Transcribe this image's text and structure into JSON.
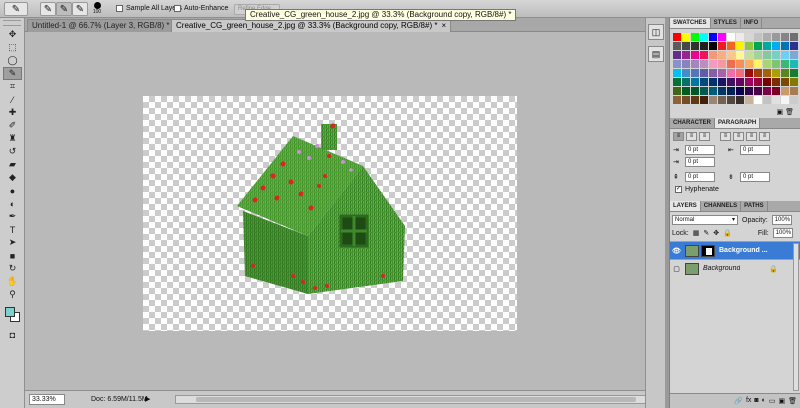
{
  "options_bar": {
    "brush_size": "100",
    "sample_all_layers": "Sample All Layers",
    "auto_enhance": "Auto-Enhance",
    "refine_edge": "Refine Edge...",
    "tooltip": "Creative_CG_green_house_2.jpg @ 33.3% (Background copy, RGB/8#) *"
  },
  "tabs": [
    {
      "label": "Untitled-1 @ 66.7% (Layer 3, RGB/8) *",
      "close": "×"
    },
    {
      "label": "Creative_CG_green_house_2.jpg @ 33.3% (Background copy, RGB/8#) *",
      "close": "×"
    }
  ],
  "status": {
    "zoom": "33.33%",
    "doc_info": "Doc: 6.59M/11.5M"
  },
  "swatches_panel": {
    "tabs": [
      "SWATCHES",
      "STYLES",
      "INFO"
    ],
    "colors": [
      "#ff0000",
      "#ffff00",
      "#00ff00",
      "#00ffff",
      "#0000ff",
      "#ff00ff",
      "#ffffff",
      "#ebebeb",
      "#d6d6d6",
      "#c2c2c2",
      "#adadad",
      "#999999",
      "#858585",
      "#707070",
      "#5c5c5c",
      "#474747",
      "#333333",
      "#1f1f1f",
      "#000000",
      "#ed1c24",
      "#f26522",
      "#fff200",
      "#8dc63f",
      "#00a651",
      "#00a99d",
      "#00aeef",
      "#0072bc",
      "#2e3192",
      "#662d91",
      "#92278f",
      "#ec008c",
      "#ed145b",
      "#f7977a",
      "#f9ad81",
      "#fdc68a",
      "#fff79a",
      "#c4df9b",
      "#a3d39c",
      "#82ca9d",
      "#7bcdc8",
      "#6ecff6",
      "#7ea7d8",
      "#8493ca",
      "#8882be",
      "#a187be",
      "#bc8dbf",
      "#f49ac2",
      "#f6989d",
      "#f26c4f",
      "#f68e55",
      "#fbaf5c",
      "#fff467",
      "#acd372",
      "#7cc576",
      "#3bb878",
      "#1abbb4",
      "#00bff3",
      "#438ccb",
      "#5574b9",
      "#605ca8",
      "#855fa8",
      "#a763a8",
      "#f06ea9",
      "#f26d7d",
      "#9e0b0f",
      "#a0410d",
      "#a3620a",
      "#aba000",
      "#598527",
      "#197b30",
      "#007236",
      "#00746b",
      "#0076a3",
      "#004a80",
      "#003471",
      "#1b1464",
      "#440e62",
      "#630460",
      "#9e005d",
      "#9e0039",
      "#790000",
      "#7b2e00",
      "#7d4900",
      "#827b00",
      "#406618",
      "#005e20",
      "#005826",
      "#005952",
      "#005b7f",
      "#003663",
      "#002157",
      "#0d004c",
      "#32004b",
      "#4b0049",
      "#7b0046",
      "#7a0026",
      "#c69c6d",
      "#a67c52",
      "#8c6239",
      "#754c24",
      "#603913",
      "#42210b",
      "#998675",
      "#736357",
      "#534741",
      "#362f2d",
      "#c7b299",
      "#ffffff",
      "#c2c2c2",
      "#e0e0e0",
      "#f5f5f5",
      "#cccccc"
    ]
  },
  "character_panel": {
    "tabs": [
      "CHARACTER",
      "PARAGRAPH"
    ],
    "indent_left": "0 pt",
    "indent_right": "0 pt",
    "indent_first": "0 pt",
    "space_before": "0 pt",
    "space_after": "0 pt",
    "hyphenate": "Hyphenate"
  },
  "layers_panel": {
    "tabs": [
      "LAYERS",
      "CHANNELS",
      "PATHS"
    ],
    "blend_mode": "Normal",
    "opacity_label": "Opacity:",
    "opacity": "100%",
    "lock_label": "Lock:",
    "fill_label": "Fill:",
    "fill": "100%",
    "layers": [
      {
        "name": "Background ...",
        "selected": true
      },
      {
        "name": "Background",
        "selected": false
      }
    ]
  }
}
